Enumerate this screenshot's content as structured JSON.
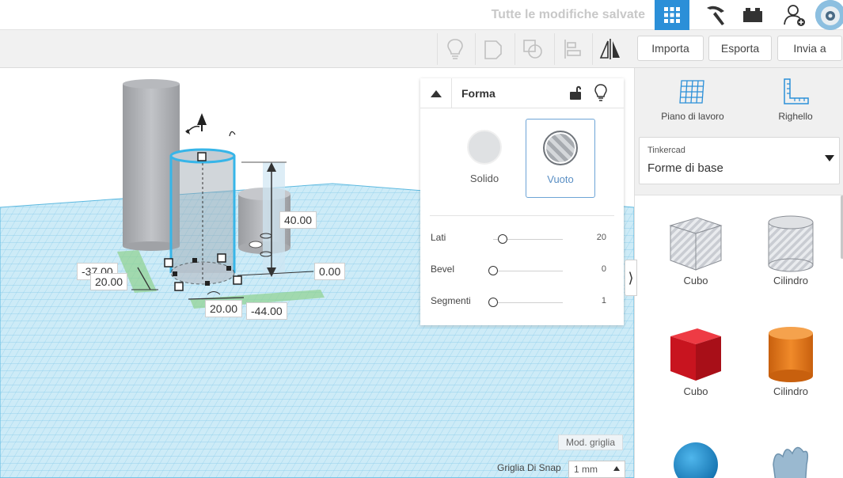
{
  "topbar": {
    "saved_status": "Tutte le modifiche salvate",
    "accent_color": "#2b8fd8"
  },
  "toolbar": {
    "import_label": "Importa",
    "export_label": "Esporta",
    "send_label": "Invia a",
    "icons": [
      "bulb-icon",
      "group-icon",
      "ungroup-icon",
      "align-icon",
      "mirror-icon"
    ]
  },
  "dimensions": {
    "height": "40.00",
    "elevation": "0.00",
    "width": "20.00",
    "depth": "20.00",
    "x_offset": "-37.00",
    "y_offset": "-44.00"
  },
  "shape_panel": {
    "title": "Forma",
    "solid_label": "Solido",
    "hole_label": "Vuoto",
    "selected_mode": "Vuoto",
    "sliders": [
      {
        "label": "Lati",
        "value": "20",
        "fraction": 0.14
      },
      {
        "label": "Bevel",
        "value": "0",
        "fraction": 0.0
      },
      {
        "label": "Segmenti",
        "value": "1",
        "fraction": 0.0
      }
    ]
  },
  "sidebar": {
    "workplane_label": "Piano di lavoro",
    "ruler_label": "Righello",
    "library_source": "Tinkercad",
    "library_name": "Forme di base",
    "shapes": [
      {
        "label": "Cubo",
        "kind": "box-hole",
        "color": "#c9ccd2"
      },
      {
        "label": "Cilindro",
        "kind": "cylinder-hole",
        "color": "#c9ccd2"
      },
      {
        "label": "Cubo",
        "kind": "box",
        "color": "#d9202a"
      },
      {
        "label": "Cilindro",
        "kind": "cylinder",
        "color": "#e8791c"
      },
      {
        "label": "",
        "kind": "sphere",
        "color": "#1f8fd0"
      },
      {
        "label": "",
        "kind": "scribble",
        "color": "#8fb2cc"
      }
    ]
  },
  "grid_controls": {
    "edit_grid_label": "Mod. griglia",
    "snap_label": "Griglia Di Snap",
    "snap_value": "1 mm"
  }
}
